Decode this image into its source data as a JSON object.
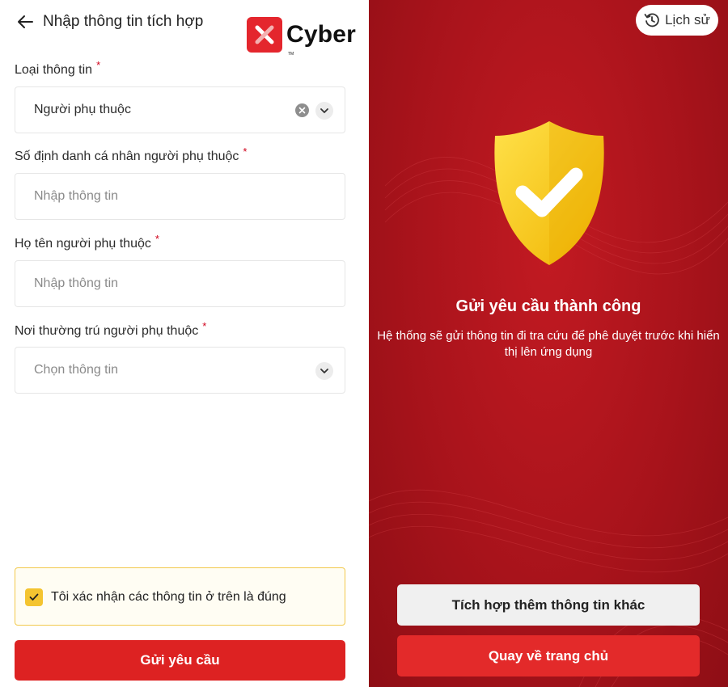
{
  "left": {
    "title": "Nhập thông tin tích hợp",
    "logo_text": "Cyber",
    "logo_tm": "TM",
    "fields": [
      {
        "label": "Loại thông tin",
        "value": "Người phụ thuộc",
        "required_mark": "*"
      },
      {
        "label": "Số định danh cá nhân người phụ thuộc",
        "placeholder": "Nhập thông tin",
        "required_mark": "*"
      },
      {
        "label": "Họ tên người phụ thuộc",
        "placeholder": "Nhập thông tin",
        "required_mark": "*"
      },
      {
        "label": "Nơi thường trú người phụ thuộc",
        "placeholder": "Chọn thông tin",
        "required_mark": "*"
      }
    ],
    "confirm_text": "Tôi xác nhận các thông tin ở trên là đúng",
    "confirm_checked": true,
    "submit_label": "Gửi yêu cầu"
  },
  "right": {
    "history_label": "Lịch sử",
    "success_title": "Gửi yêu cầu thành công",
    "success_desc": "Hệ thống sẽ gửi thông tin đi tra cứu để phê duyệt trước khi hiển thị lên ứng dụng",
    "btn_integrate": "Tích hợp thêm thông tin khác",
    "btn_home": "Quay về trang chủ"
  },
  "colors": {
    "brand_red": "#dd2222",
    "panel_red": "#b3151d",
    "checkbox_yellow": "#f4c430",
    "shield_yellow": "#f7cc2a"
  }
}
